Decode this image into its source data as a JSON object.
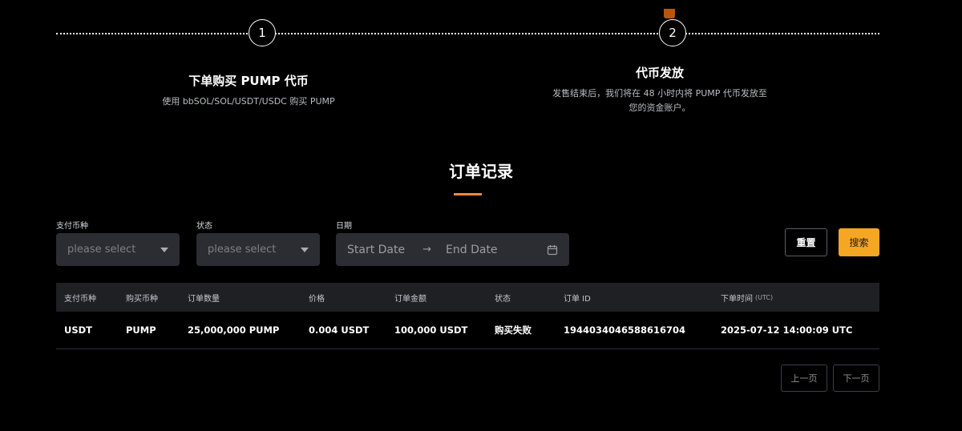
{
  "steps": [
    {
      "number": "1",
      "title": "下单购买 PUMP 代币",
      "desc": "使用 bbSOL/SOL/USDT/USDC 购买 PUMP"
    },
    {
      "number": "2",
      "title": "代币发放",
      "desc_line1": "发售结束后，我们将在 48 小时内将 PUMP 代币发放至",
      "desc_line2": "您的资金账户。"
    }
  ],
  "orders": {
    "title": "订单记录",
    "accent_color": "#f7893a",
    "filters": {
      "currency": {
        "label": "支付币种",
        "placeholder": "please select"
      },
      "status": {
        "label": "状态",
        "placeholder": "please select"
      },
      "date": {
        "label": "日期",
        "start_placeholder": "Start Date",
        "end_placeholder": "End Date"
      }
    },
    "buttons": {
      "reset": "重置",
      "search": "搜索",
      "search_color": "#f5a623"
    },
    "table": {
      "headers": {
        "pay_currency": "支付币种",
        "buy_currency": "购买币种",
        "quantity": "订单数量",
        "price": "价格",
        "amount": "订单金额",
        "status": "状态",
        "order_id": "订单 ID",
        "time": "下单时间",
        "time_tz": "(UTC)"
      },
      "rows": [
        {
          "pay_currency": "USDT",
          "buy_currency": "PUMP",
          "quantity": "25,000,000 PUMP",
          "price": "0.004 USDT",
          "amount": "100,000 USDT",
          "status": "购买失败",
          "order_id": "1944034046588616704",
          "time": "2025-07-12 14:00:09 UTC"
        }
      ]
    },
    "pagination": {
      "prev": "上一页",
      "next": "下一页"
    }
  }
}
